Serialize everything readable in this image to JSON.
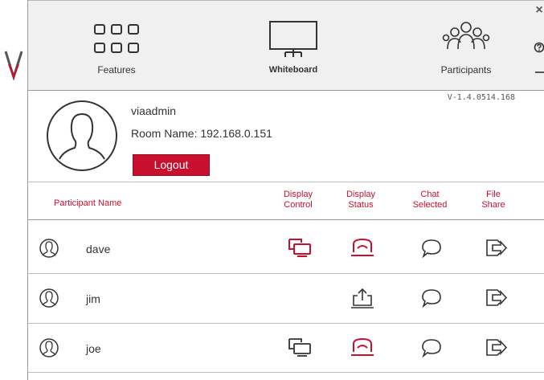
{
  "toolbar": {
    "features_label": "Features",
    "whiteboard_label": "Whiteboard",
    "participants_label": "Participants",
    "close_glyph": "×"
  },
  "profile": {
    "username": "viaadmin",
    "room_name": "Room Name: 192.168.0.151",
    "logout_label": "Logout",
    "version": "V-1.4.0514.168"
  },
  "table": {
    "headers": {
      "participant_name": "Participant Name",
      "display_control_line1": "Display",
      "display_control_line2": "Control",
      "display_status_line1": "Display",
      "display_status_line2": "Status",
      "chat_line1": "Chat",
      "chat_line2": "Selected",
      "file_line1": "File",
      "file_line2": "Share"
    },
    "rows": [
      {
        "name": "dave",
        "display_control": "active-red",
        "display_status": "presenting-red",
        "chat": "chat-bubble",
        "file_share": "share-arrow"
      },
      {
        "name": "jim",
        "display_control": "none",
        "display_status": "upload-black",
        "chat": "chat-bubble",
        "file_share": "share-arrow"
      },
      {
        "name": "joe",
        "display_control": "inactive-black",
        "display_status": "presenting-red",
        "chat": "chat-bubble",
        "file_share": "share-arrow"
      }
    ]
  },
  "colors": {
    "accent": "#c8102e",
    "icon_dark": "#333333",
    "toolbar_bg": "#f0f0f0"
  }
}
